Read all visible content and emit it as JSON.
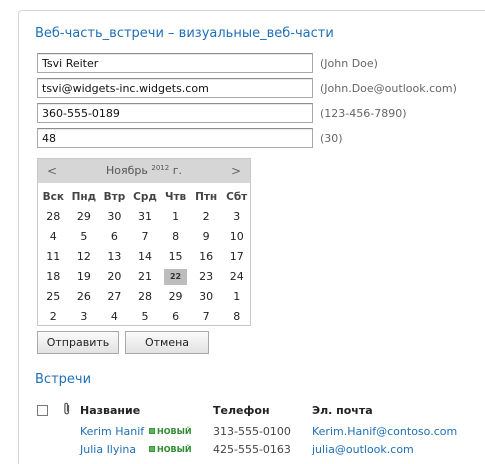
{
  "webpart": {
    "title": "Веб-часть_встречи – визуальные_веб-части"
  },
  "form": {
    "fields": [
      {
        "value": "Tsvi Reiter",
        "hint": "(John Doe)"
      },
      {
        "value": "tsvi@widgets-inc.widgets.com",
        "hint": "(John.Doe@outlook.com)"
      },
      {
        "value": "360-555-0189",
        "hint": "(123-456-7890)"
      },
      {
        "value": "48",
        "hint": "(30)"
      }
    ]
  },
  "calendar": {
    "prev": "<",
    "next": ">",
    "month": "Ноябрь",
    "year": "2012",
    "year_suffix": "г.",
    "weekdays": [
      "Вск",
      "Пнд",
      "Втр",
      "Срд",
      "Чтв",
      "Птн",
      "Сбт"
    ],
    "days": [
      "28",
      "29",
      "30",
      "31",
      "1",
      "2",
      "3",
      "4",
      "5",
      "6",
      "7",
      "8",
      "9",
      "10",
      "11",
      "12",
      "13",
      "14",
      "15",
      "16",
      "17",
      "18",
      "19",
      "20",
      "21",
      "22",
      "23",
      "24",
      "25",
      "26",
      "27",
      "28",
      "29",
      "30",
      "1",
      "2",
      "3",
      "4",
      "5",
      "6",
      "7",
      "8"
    ],
    "today_index": 25
  },
  "buttons": {
    "send": "Отправить",
    "cancel": "Отмена"
  },
  "meetings": {
    "title": "Встречи",
    "columns": {
      "name": "Название",
      "phone": "Телефон",
      "email": "Эл. почта"
    },
    "new_label": "НОВЫЙ",
    "rows": [
      {
        "name": "Kerim Hanif",
        "phone": "313-555-0100",
        "email": "Kerim.Hanif@contoso.com"
      },
      {
        "name": "Julia Ilyina",
        "phone": "425-555-0163",
        "email": "julia@outlook.com"
      }
    ]
  },
  "colors": {
    "accent": "#1f6fb5",
    "new_badge": "#2e8b2e"
  }
}
